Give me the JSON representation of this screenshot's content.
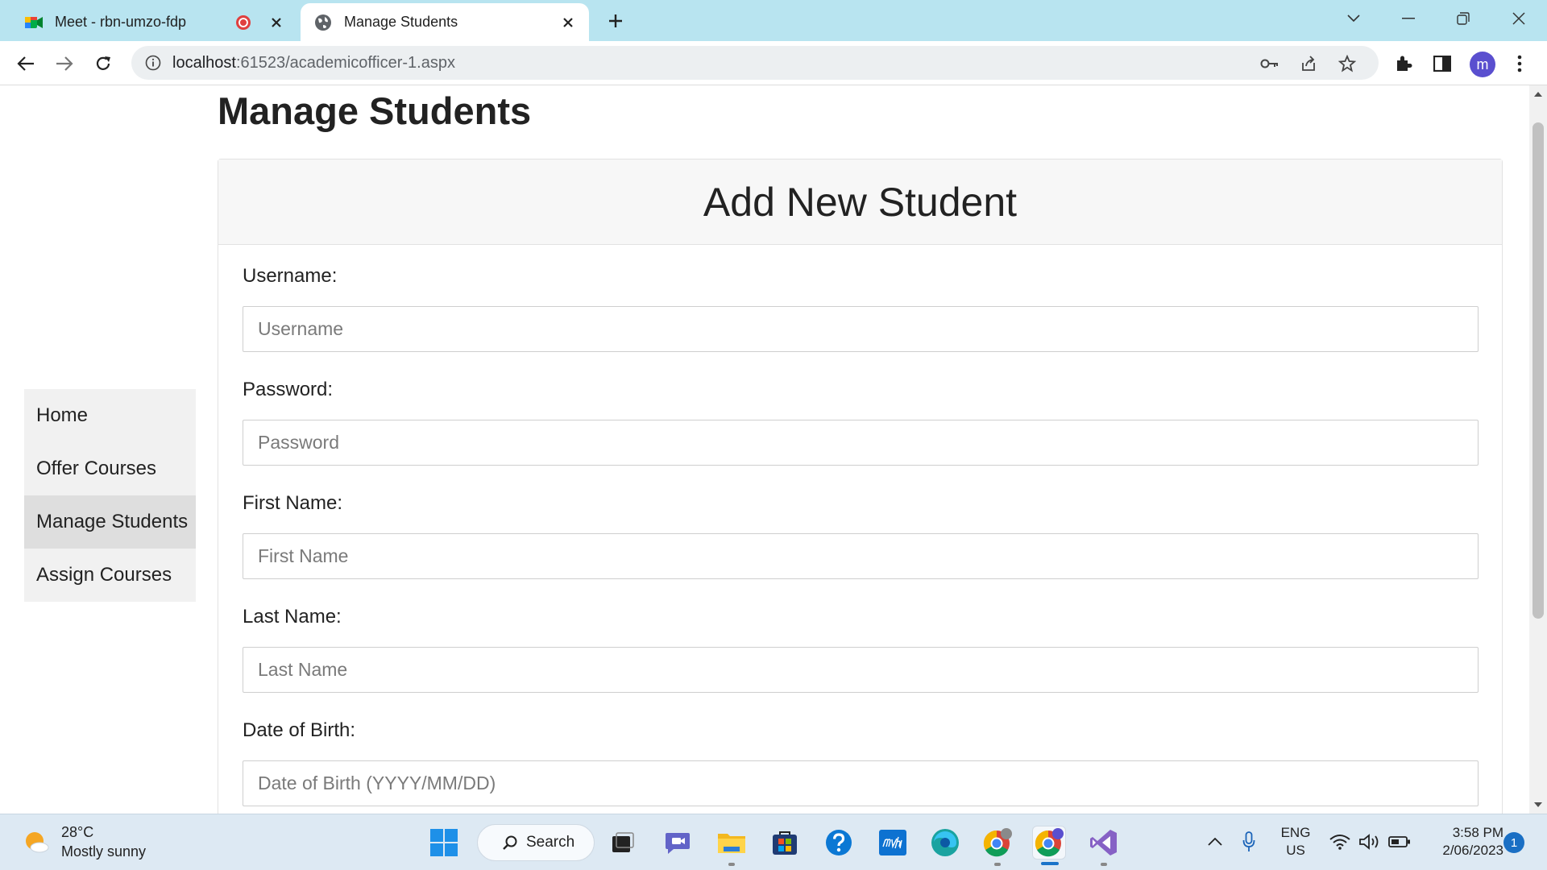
{
  "browser": {
    "tabs": [
      {
        "title": "Meet - rbn-umzo-fdp",
        "recording": true,
        "active": false
      },
      {
        "title": "Manage Students",
        "active": true
      }
    ],
    "url_host": "localhost",
    "url_path": ":61523/academicofficer-1.aspx",
    "profile_initial": "m"
  },
  "page": {
    "title": "Manage Students",
    "nav": [
      {
        "label": "Home",
        "active": false
      },
      {
        "label": "Offer Courses",
        "active": false
      },
      {
        "label": "Manage Students",
        "active": true
      },
      {
        "label": "Assign Courses",
        "active": false
      }
    ],
    "card_title": "Add New Student",
    "fields": [
      {
        "label": "Username:",
        "placeholder": "Username",
        "value": ""
      },
      {
        "label": "Password:",
        "placeholder": "Password",
        "value": ""
      },
      {
        "label": "First Name:",
        "placeholder": "First Name",
        "value": ""
      },
      {
        "label": "Last Name:",
        "placeholder": "Last Name",
        "value": ""
      },
      {
        "label": "Date of Birth:",
        "placeholder": "Date of Birth (YYYY/MM/DD)",
        "value": ""
      }
    ]
  },
  "taskbar": {
    "weather_temp": "28°C",
    "weather_desc": "Mostly sunny",
    "search_label": "Search",
    "lang_line1": "ENG",
    "lang_line2": "US",
    "time": "3:58 PM",
    "date": "2/06/2023",
    "notification_count": "1"
  },
  "colors": {
    "tabstrip": "#b8e4f0",
    "accent": "#1a73c9",
    "active_nav": "#dedede"
  }
}
